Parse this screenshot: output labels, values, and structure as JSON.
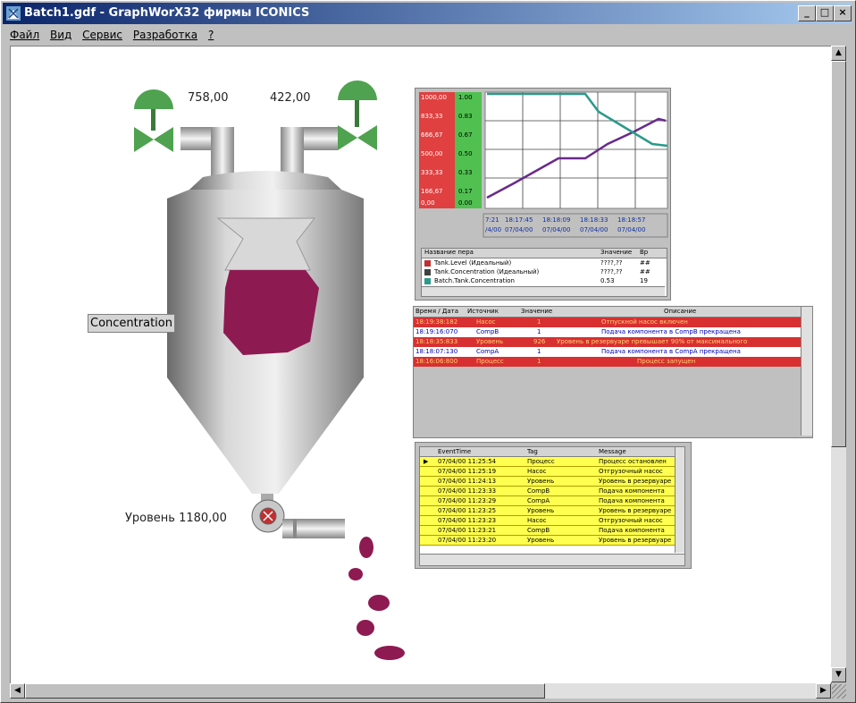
{
  "window": {
    "title": "Batch1.gdf - GraphWorX32 фирмы ICONICS",
    "btn_min": "_",
    "btn_max": "□",
    "btn_close": "×"
  },
  "menu": [
    "Файл",
    "Вид",
    "Сервис",
    "Разработка",
    "?"
  ],
  "scene": {
    "valve_left_value": "758,00",
    "valve_right_value": "422,00",
    "concentration_label": "Concentration",
    "level_label": "Уровень 1180,00"
  },
  "colors": {
    "product": "#8e1a52",
    "valve": "#4fa24f",
    "trend_purple": "#6a2a8a",
    "trend_teal": "#2a9a8a",
    "alarm_red": "#d83030"
  },
  "trend": {
    "left_axis": [
      "1000,00",
      "833,33",
      "666,67",
      "500,00",
      "333,33",
      "166,67",
      "0,00"
    ],
    "right_axis": [
      "1.00",
      "0.83",
      "0.67",
      "0.50",
      "0.33",
      "0.17",
      "0.00"
    ],
    "time_labels": [
      "7:21",
      "18:17:45",
      "18:18:09",
      "18:18:33",
      "18:18:57"
    ],
    "date_labels": [
      "/4/00",
      "07/04/00",
      "07/04/00",
      "07/04/00",
      "07/04/00"
    ],
    "legend_headers": [
      "Название пера",
      "Значение",
      "Вр"
    ],
    "legend_rows": [
      {
        "name": "Tank.Level (Идеальный)",
        "value": "????,??",
        "extra": "##",
        "color": "#c03030"
      },
      {
        "name": "Tank.Concentration (Идеальный)",
        "value": "????,??",
        "extra": "##",
        "color": "#404040"
      },
      {
        "name": "Batch.Tank.Concentration",
        "value": "0.53",
        "extra": "19",
        "color": "#2a9a8a"
      }
    ]
  },
  "alarms": {
    "headers": [
      "Время / Дата",
      "Источник",
      "Значение",
      "Описание"
    ],
    "rows": [
      {
        "time": "18:19:38:182",
        "source": "Насос",
        "value": "1",
        "desc": "Отпускной насос включен",
        "style": "red"
      },
      {
        "time": "18:19:16:070",
        "source": "CompB",
        "value": "1",
        "desc": "Подача компонента в CompB прекращена",
        "style": "white"
      },
      {
        "time": "18:18:35:833",
        "source": "Уровень",
        "value": "926",
        "desc": "Уровень в резервуаре превышает 90% от максимального",
        "style": "red"
      },
      {
        "time": "18:18:07:130",
        "source": "CompA",
        "value": "1",
        "desc": "Подача компонента в CompA прекращена",
        "style": "white"
      },
      {
        "time": "18:16:06:800",
        "source": "Процесс",
        "value": "1",
        "desc": "Процесс запущен",
        "style": "red"
      }
    ]
  },
  "events": {
    "headers": [
      "EventTime",
      "Tag",
      "Message"
    ],
    "rows": [
      {
        "time": "07/04/00 11:25:54",
        "tag": "Процесс",
        "msg": "Процесс остановлен"
      },
      {
        "time": "07/04/00 11:25:19",
        "tag": "Насос",
        "msg": "Отгрузочный насос"
      },
      {
        "time": "07/04/00 11:24:13",
        "tag": "Уровень",
        "msg": "Уровень в резервуаре"
      },
      {
        "time": "07/04/00 11:23:33",
        "tag": "CompB",
        "msg": "Подача компонента"
      },
      {
        "time": "07/04/00 11:23:29",
        "tag": "CompA",
        "msg": "Подача компонента"
      },
      {
        "time": "07/04/00 11:23:25",
        "tag": "Уровень",
        "msg": "Уровень в резервуаре"
      },
      {
        "time": "07/04/00 11:23:23",
        "tag": "Насос",
        "msg": "Отгрузочный насос"
      },
      {
        "time": "07/04/00 11:23:21",
        "tag": "CompB",
        "msg": "Подача компонента"
      },
      {
        "time": "07/04/00 11:23:20",
        "tag": "Уровень",
        "msg": "Уровень в резервуаре"
      }
    ]
  }
}
